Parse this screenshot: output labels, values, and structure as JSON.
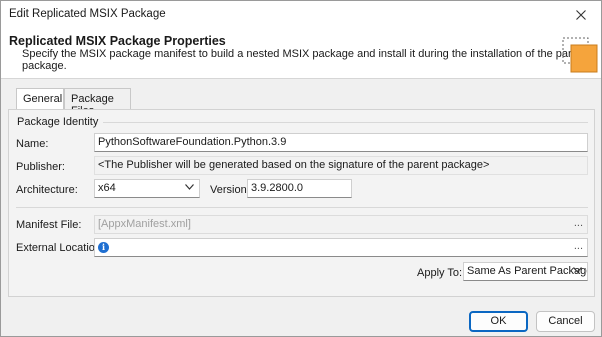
{
  "window": {
    "title": "Edit Replicated MSIX Package"
  },
  "header": {
    "title": "Replicated MSIX Package Properties",
    "description": "Specify the MSIX package manifest to build a nested MSIX package and install it during the installation of the parent package.",
    "icon": "package-icon"
  },
  "tabs": [
    {
      "label": "General",
      "active": true
    },
    {
      "label": "Package Files",
      "active": false
    }
  ],
  "identity": {
    "group_label": "Package Identity",
    "name_label": "Name:",
    "name_value": "PythonSoftwareFoundation.Python.3.9",
    "publisher_label": "Publisher:",
    "publisher_value": "<The Publisher will be generated based on the signature of the parent package>",
    "architecture_label": "Architecture:",
    "architecture_value": "x64",
    "version_label": "Version:",
    "version_value": "3.9.2800.0"
  },
  "manifest": {
    "label": "Manifest File:",
    "placeholder": "[AppxManifest.xml]",
    "browse": "..."
  },
  "external": {
    "label": "External Location:",
    "value": "",
    "browse": "..."
  },
  "apply_to": {
    "label": "Apply To:",
    "value": "Same As Parent Package"
  },
  "buttons": {
    "ok": "OK",
    "cancel": "Cancel"
  },
  "colors": {
    "accent": "#0b67c2",
    "package_icon": "#f5a43c",
    "info_icon": "#1f6fd1"
  }
}
